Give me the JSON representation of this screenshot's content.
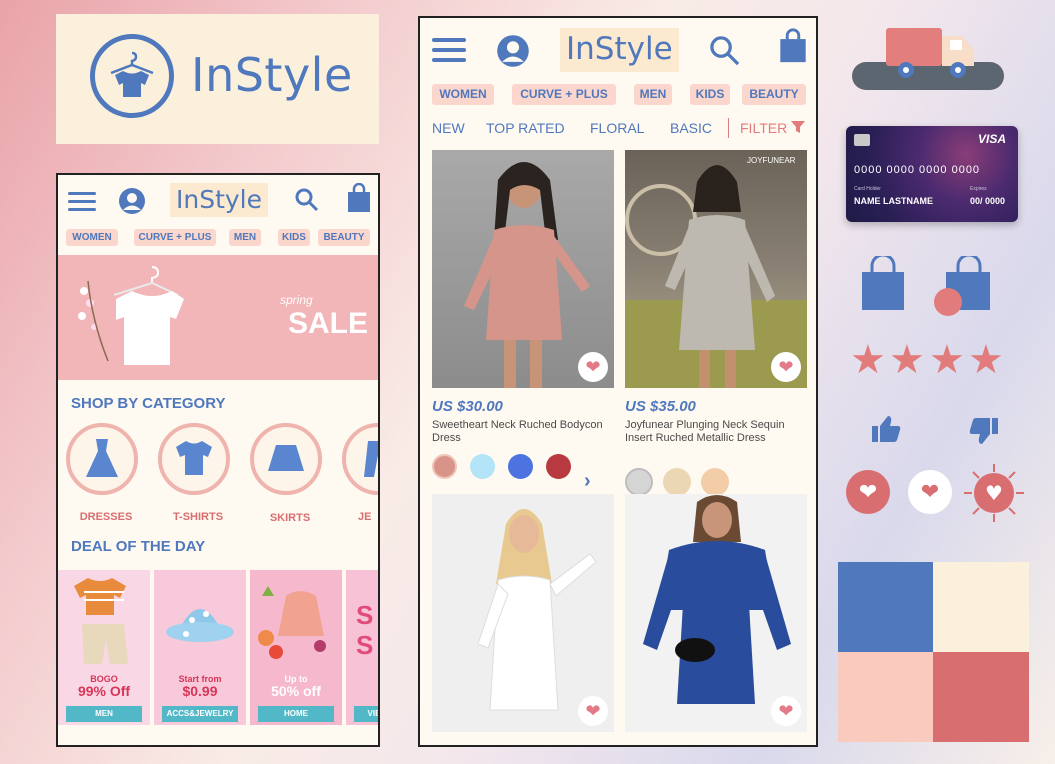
{
  "brand": {
    "name": "InStyle"
  },
  "nav": {
    "chips": [
      "WOMEN",
      "CURVE + PLUS",
      "MEN",
      "KIDS",
      "BEAUTY"
    ],
    "tabs": [
      "NEW",
      "TOP RATED",
      "FLORAL",
      "BASIC"
    ],
    "filter_label": "FILTER"
  },
  "home": {
    "banner_script": "spring",
    "banner_sale": "SALE",
    "section_category": "SHOP BY CATEGORY",
    "categories": [
      "DRESSES",
      "T-SHIRTS",
      "SKIRTS",
      "JE"
    ],
    "section_deal": "DEAL OF THE DAY",
    "deals": [
      {
        "promo_top": "BOGO",
        "promo_main": "99% Off",
        "tag": "MEN"
      },
      {
        "promo_top": "Start from",
        "promo_main": "$0.99",
        "tag": "ACCS&JEWELRY"
      },
      {
        "promo_top": "Up to",
        "promo_main": "50% off",
        "tag": "HOME"
      },
      {
        "promo_top": "S",
        "promo_main": "S",
        "tag": "VIE"
      }
    ]
  },
  "products": [
    {
      "price": "US $30.00",
      "name": "Sweetheart Neck Ruched Bodycon Dress",
      "swatches": [
        "#d9948a",
        "#b3e4f7",
        "#4c73e0",
        "#b8393f"
      ]
    },
    {
      "price": "US $35.00",
      "name": "Joyfunear Plunging Neck Sequin Insert Ruched Metallic Dress",
      "swatches": [
        "#d5d5d5",
        "#ecd7b5",
        "#f2cda8"
      ],
      "image_watermark": "JOYFUNEAR"
    },
    {
      "price": "",
      "name": ""
    },
    {
      "price": "",
      "name": ""
    }
  ],
  "credit_card": {
    "network": "VISA",
    "number": "0000 0000 0000 0000",
    "holder_label": "Card Holder",
    "holder_name": "NAME LASTNAME",
    "expiry_label": "Expires",
    "expiry": "00/ 0000"
  },
  "palette": [
    "#4f78bd",
    "#fbf0dc",
    "#fbcabf",
    "#d96e70"
  ],
  "colors": {
    "accent_blue": "#4f78bd",
    "accent_pink": "#e27b87",
    "chip_bg": "#fbd6cc"
  },
  "icons": [
    "menu-icon",
    "user-icon",
    "search-icon",
    "shopping-bag-icon",
    "heart-icon",
    "truck-icon",
    "star-icon",
    "thumbs-up-icon",
    "thumbs-down-icon",
    "filter-icon",
    "chevron-right-icon"
  ],
  "rating": {
    "stars": 4,
    "max": 4
  }
}
